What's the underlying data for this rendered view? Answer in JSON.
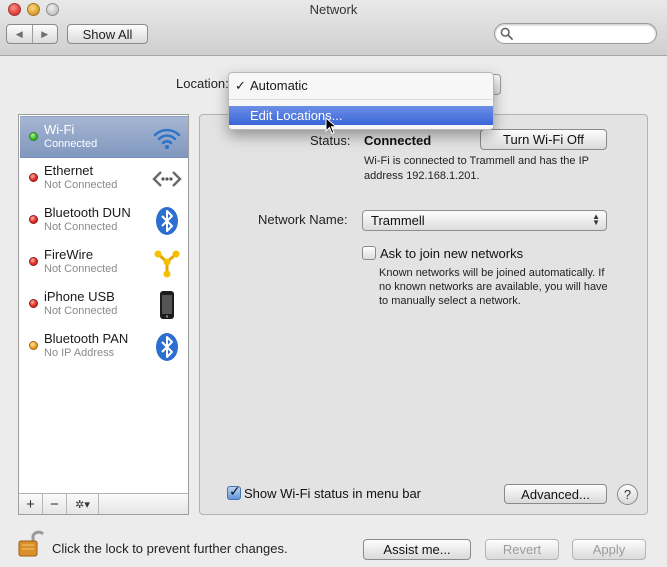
{
  "window": {
    "title": "Network"
  },
  "toolbar": {
    "back_glyph": "◀",
    "forward_glyph": "▶",
    "show_all_label": "Show All",
    "search_placeholder": ""
  },
  "location": {
    "label": "Location:",
    "menu": {
      "checkmark": "✓",
      "items": [
        {
          "label": "Automatic",
          "checked": true
        },
        {
          "label": "Edit Locations...",
          "highlighted": true
        }
      ]
    }
  },
  "sidebar": {
    "services": [
      {
        "name": "Wi-Fi",
        "status": "Connected",
        "dot": "green",
        "icon": "wifi-icon",
        "selected": true
      },
      {
        "name": "Ethernet",
        "status": "Not Connected",
        "dot": "red",
        "icon": "ethernet-icon"
      },
      {
        "name": "Bluetooth DUN",
        "status": "Not Connected",
        "dot": "red",
        "icon": "bluetooth-icon"
      },
      {
        "name": "FireWire",
        "status": "Not Connected",
        "dot": "red",
        "icon": "firewire-icon"
      },
      {
        "name": "iPhone USB",
        "status": "Not Connected",
        "dot": "red",
        "icon": "iphone-icon"
      },
      {
        "name": "Bluetooth PAN",
        "status": "No IP Address",
        "dot": "yellow",
        "icon": "bluetooth-icon"
      }
    ],
    "add_label": "+",
    "remove_label": "−",
    "action_label": "✲▾"
  },
  "detail": {
    "status_label": "Status:",
    "status_value": "Connected",
    "turn_off_label": "Turn Wi-Fi Off",
    "status_desc": "Wi-Fi is connected to Trammell and has the IP address 192.168.1.201.",
    "network_name_label": "Network Name:",
    "network_name_value": "Trammell",
    "ask_join_label": "Ask to join new networks",
    "ask_join_checked": false,
    "ask_join_desc": "Known networks will be joined automatically. If no known networks are available, you will have to manually select a network.",
    "show_status_label": "Show Wi-Fi status in menu bar",
    "show_status_checked": true,
    "advanced_label": "Advanced...",
    "help_label": "?"
  },
  "footer": {
    "lock_text": "Click the lock to prevent further changes.",
    "assist_label": "Assist me...",
    "revert_label": "Revert",
    "apply_label": "Apply"
  },
  "colors": {
    "selection": "#8097bf",
    "menu_highlight": "#3a65d8",
    "status_green": "#3fbf28",
    "status_red": "#e3302a",
    "status_yellow": "#f3a526"
  }
}
